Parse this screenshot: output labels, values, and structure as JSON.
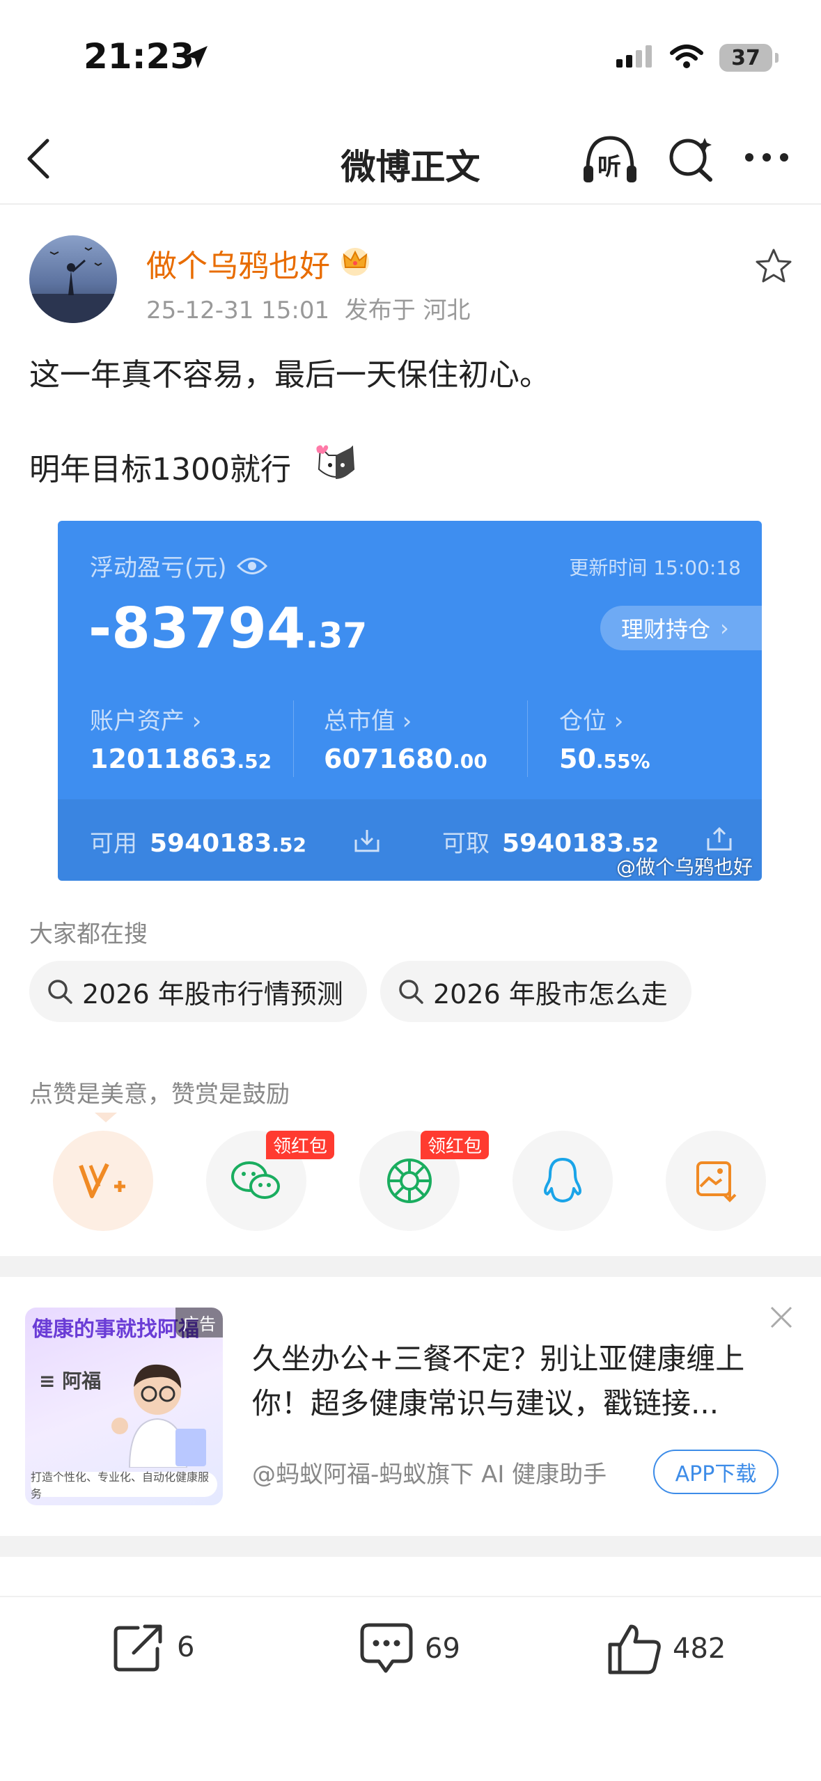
{
  "status_bar": {
    "time": "21:23",
    "battery": "37"
  },
  "nav": {
    "title": "微博正文",
    "listen_label": "听"
  },
  "post": {
    "username": "做个乌鸦也好",
    "timestamp": "25-12-31 15:01",
    "location": "发布于 河北",
    "line1": "这一年真不容易，最后一天保住初心。",
    "line2": "明年目标1300就行"
  },
  "card": {
    "pnl_label": "浮动盈亏(元)",
    "update_label": "更新时间 15:00:18",
    "pnl_main": "-83794",
    "pnl_decimal": ".37",
    "holdings_button": "理财持仓",
    "account_assets_label": "账户资产",
    "account_assets_main": "12011863",
    "account_assets_decimal": ".52",
    "market_value_label": "总市值",
    "market_value_main": "6071680",
    "market_value_decimal": ".00",
    "position_label": "仓位",
    "position_main": "50",
    "position_decimal": ".55%",
    "available_label": "可用",
    "available_main": "5940183",
    "available_decimal": ".52",
    "withdrawable_label": "可取",
    "withdrawable_main": "5940183",
    "withdrawable_decimal": ".52",
    "watermark": "@做个乌鸦也好"
  },
  "search": {
    "label": "大家都在搜",
    "chips": [
      "2026 年股市行情预测",
      "2026 年股市怎么走"
    ]
  },
  "reward": {
    "label": "点赞是美意，赞赏是鼓励",
    "badge": "领红包"
  },
  "ad": {
    "image_title": "健康的事就找阿福",
    "ad_tag": "广告",
    "brand": "阿福",
    "image_caption": "打造个性化、专业化、自动化健康服务",
    "text": "久坐办公+三餐不定？别让亚健康缠上你！超多健康常识与建议，戳链接...",
    "source": "@蚂蚁阿福-蚂蚁旗下 AI 健康助手",
    "button": "APP下载"
  },
  "bottom": {
    "repost_count": "6",
    "comment_count": "69",
    "like_count": "482"
  },
  "colors": {
    "accent_orange": "#e86c00",
    "card_blue": "#3e8ef0",
    "link_blue": "#3d8ce8",
    "badge_red": "#ff3b30"
  }
}
